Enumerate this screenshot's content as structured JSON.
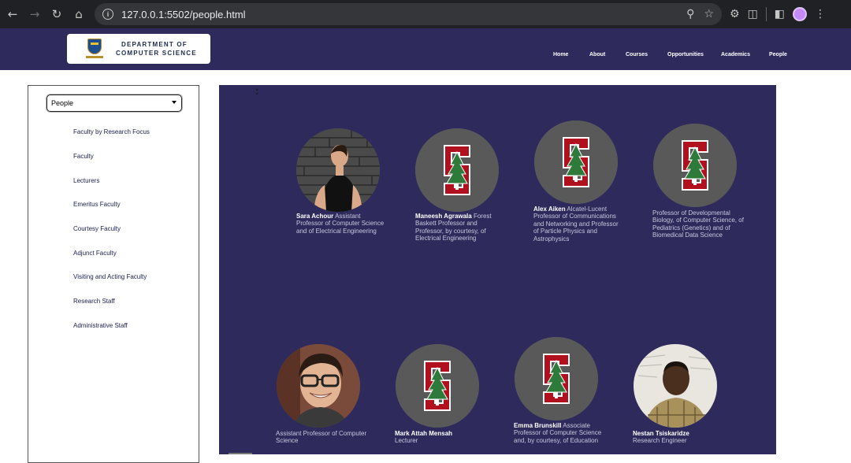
{
  "browser": {
    "url": "127.0.0.1:5502/people.html"
  },
  "header": {
    "logo_line1": "DEPARTMENT OF",
    "logo_line2": "COMPUTER SCIENCE",
    "nav": [
      {
        "label": "Home"
      },
      {
        "label": "About"
      },
      {
        "label": "Courses"
      },
      {
        "label": "Opportunities"
      },
      {
        "label": "Academics"
      },
      {
        "label": "People"
      }
    ]
  },
  "sidebar": {
    "selected": "People",
    "items": [
      {
        "label": "Faculty by Research Focus"
      },
      {
        "label": "Faculty"
      },
      {
        "label": "Lecturers"
      },
      {
        "label": "Emeritus Faculty"
      },
      {
        "label": "Courtesy Faculty"
      },
      {
        "label": "Adjunct Faculty"
      },
      {
        "label": "Visiting and Acting Faculty"
      },
      {
        "label": "Research Staff"
      },
      {
        "label": "Administrative Staff"
      }
    ]
  },
  "people": [
    {
      "name": "Sara Achour",
      "title": "Assistant Professor of Computer Science and of Electrical Engineering",
      "photo": "portrait-photo"
    },
    {
      "name": "Maneesh Agrawala",
      "title": "Forest Baskett Professor and Professor, by courtesy, of Electrical Engineering",
      "photo": "stanford-logo"
    },
    {
      "name": "Alex Aiken",
      "title": "Alcatel-Lucent Professor of Communications and Networking and Professor of Particle Physics and Astrophysics",
      "photo": "stanford-logo"
    },
    {
      "name": "",
      "title": "Professor of Developmental Biology, of Computer Science, of Pediatrics (Genetics) and of Biomedical Data Science",
      "photo": "stanford-logo"
    },
    {
      "name": "",
      "title": "Assistant Professor of Computer Science",
      "photo": "portrait-photo"
    },
    {
      "name": "Mark Attah Mensah",
      "title": "Lecturer",
      "photo": "stanford-logo"
    },
    {
      "name": "Emma Brunskill",
      "title": "Associate Professor of Computer Science and, by courtesy, of Education",
      "photo": "stanford-logo"
    },
    {
      "name": "Nestan Tsiskaridze",
      "title": "Research Engineer",
      "photo": "portrait-photo"
    }
  ],
  "colors": {
    "header_bg": "#2e2a5c",
    "panel_bg": "#2e2a5c",
    "stanford_red": "#b1101f",
    "tree_green": "#2d7a3a"
  }
}
